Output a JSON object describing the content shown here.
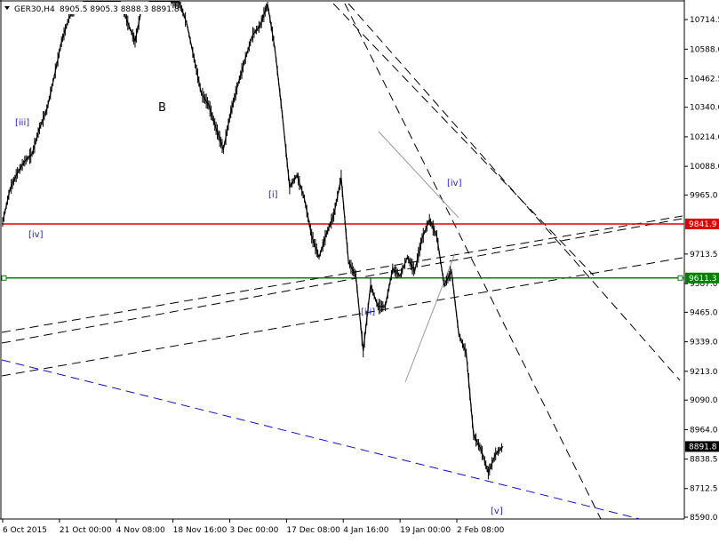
{
  "header": {
    "symbol_label": "GER30,H4",
    "ohlc_text": "8905.5 8905.3 8888.3 8891.8"
  },
  "colors": {
    "candles": "#000000",
    "red_line": "#e00000",
    "green_line": "#008000",
    "wave_label": "#2020c8",
    "blue_trend": "#1010c0",
    "price_tag_bg": "#000000",
    "red_tag_bg": "#e00000",
    "green_tag_bg": "#008000"
  },
  "price_axis": {
    "ticks": [
      "10714.5",
      "10588.0",
      "10462.5",
      "10340.0",
      "10214.0",
      "10088.0",
      "9965.0",
      "9713.5",
      "9587.0",
      "9465.0",
      "9339.0",
      "9213.0",
      "9090.0",
      "8964.0",
      "8838.5",
      "8712.5",
      "8590.0"
    ]
  },
  "time_axis": {
    "ticks": [
      "6 Oct 2015",
      "21 Oct 00:00",
      "4 Nov 08:00",
      "18 Nov 16:00",
      "3 Dec 00:00",
      "17 Dec 08:00",
      "4 Jan 16:00",
      "19 Jan 00:00",
      "2 Feb 08:00"
    ]
  },
  "price_tags": {
    "red_level": "9841.9",
    "green_level": "9611.3",
    "current": "8891.8"
  },
  "wave_labels": {
    "iii_left": "[iii]",
    "B": "B",
    "iv_left": "[iv]",
    "i": "[i]",
    "iv_right": "[iv]",
    "iii_mid": "[iii]",
    "v": "[v]"
  },
  "chart_data": {
    "type": "line",
    "title": "GER30,H4",
    "ylim": [
      8590,
      10800
    ],
    "ohlc": {
      "open": 8905.5,
      "high": 8905.3,
      "low": 8888.3,
      "close": 8891.8
    },
    "horizontal_levels": [
      {
        "value": 9841.9,
        "color": "#e00000"
      },
      {
        "value": 9611.3,
        "color": "#008000"
      }
    ],
    "series": [
      {
        "x": [
          "6 Oct 2015",
          "8 Oct",
          "12 Oct",
          "14 Oct",
          "16 Oct",
          "19 Oct",
          "21 Oct 00:00",
          "22 Oct",
          "23 Oct",
          "26 Oct",
          "28 Oct",
          "30 Oct",
          "2 Nov",
          "4 Nov 08:00",
          "6 Nov",
          "9 Nov",
          "11 Nov",
          "13 Nov",
          "16 Nov",
          "18 Nov 16:00",
          "20 Nov",
          "23 Nov",
          "25 Nov",
          "27 Nov",
          "30 Nov",
          "1 Dec",
          "3 Dec 00:00",
          "4 Dec",
          "7 Dec",
          "9 Dec",
          "11 Dec",
          "14 Dec",
          "16 Dec",
          "17 Dec 08:00",
          "18 Dec",
          "21 Dec",
          "23 Dec",
          "28 Dec",
          "30 Dec",
          "4 Jan 16:00",
          "5 Jan",
          "6 Jan",
          "7 Jan",
          "8 Jan",
          "11 Jan",
          "12 Jan",
          "13 Jan",
          "14 Jan",
          "15 Jan",
          "18 Jan",
          "19 Jan 00:00",
          "20 Jan",
          "21 Jan",
          "22 Jan",
          "25 Jan",
          "26 Jan",
          "27 Jan",
          "28 Jan",
          "29 Jan",
          "1 Feb",
          "2 Feb 08:00",
          "3 Feb",
          "4 Feb",
          "5 Feb",
          "8 Feb",
          "9 Feb",
          "10 Feb",
          "11 Feb",
          "12 Feb"
        ],
        "values": [
          9850,
          9990,
          10060,
          10110,
          10140,
          10250,
          10330,
          10470,
          10620,
          10720,
          10770,
          10820,
          10820,
          10820,
          10800,
          10790,
          10790,
          10700,
          10620,
          10780,
          10800,
          10820,
          10820,
          10820,
          10790,
          10700,
          10550,
          10400,
          10350,
          10250,
          10160,
          10320,
          10440,
          10550,
          10650,
          10690,
          10780,
          10590,
          10310,
          10000,
          10050,
          9950,
          9790,
          9700,
          9800,
          9880,
          10040,
          9680,
          9620,
          9300,
          9580,
          9490,
          9490,
          9650,
          9620,
          9700,
          9640,
          9780,
          9860,
          9790,
          9580,
          9640,
          9370,
          9290,
          8940,
          8880,
          8780,
          8860,
          8891.8
        ]
      }
    ]
  }
}
